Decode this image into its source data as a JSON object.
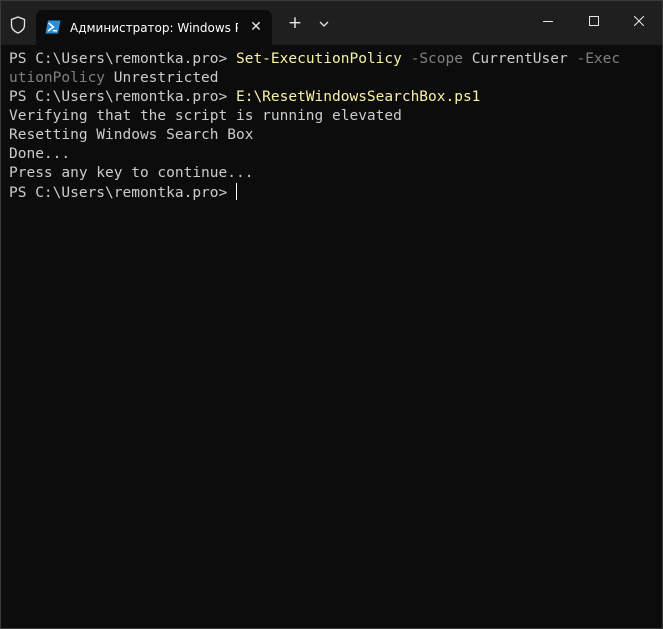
{
  "titlebar": {
    "tab_title": "Администратор: Windows PowerShell",
    "tab_close": "✕",
    "new_tab": "+"
  },
  "terminal": {
    "lines": [
      {
        "prompt": "PS C:\\Users\\remontka.pro> ",
        "command": "Set-ExecutionPolicy",
        "param1": " -Scope",
        "arg1": " CurrentUser",
        "param2": " -Exec"
      },
      {
        "param2_cont": "utionPolicy",
        "arg2": " Unrestricted"
      },
      {
        "prompt": "PS C:\\Users\\remontka.pro> ",
        "command": "E:\\ResetWindowsSearchBox.ps1"
      },
      {
        "text": "Verifying that the script is running elevated"
      },
      {
        "text": "Resetting Windows Search Box"
      },
      {
        "text": "Done..."
      },
      {
        "text": "Press any key to continue..."
      },
      {
        "prompt": "PS C:\\Users\\remontka.pro> "
      }
    ]
  },
  "colors": {
    "background": "#0c0c0c",
    "titlebar": "#1f1f1f",
    "command": "#f9f1a5",
    "parameter": "#808080",
    "text": "#cccccc",
    "powershell_icon": "#2d8fd5"
  },
  "icons": {
    "shield": "shield-icon",
    "tab": "powershell-icon",
    "dropdown": "chevron-down-icon",
    "minimize": "minimize-icon",
    "maximize": "maximize-icon",
    "close": "close-icon"
  }
}
